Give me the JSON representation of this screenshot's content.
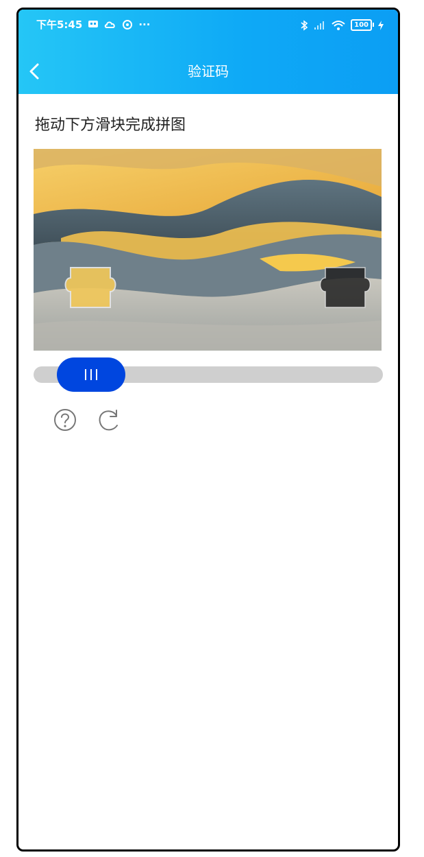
{
  "status_bar": {
    "time": "下午5:45",
    "overflow": "···",
    "battery": "100"
  },
  "navbar": {
    "title": "验证码",
    "back_icon": "chevron-left-icon"
  },
  "captcha": {
    "instruction": "拖动下方滑块完成拼图",
    "slider_progress": 0.0,
    "actions": [
      "help-icon",
      "refresh-icon"
    ]
  },
  "colors": {
    "header_start": "#25c6f6",
    "header_end": "#0c9ef4",
    "slider_handle": "#0046df",
    "track": "#cfcfcf"
  }
}
